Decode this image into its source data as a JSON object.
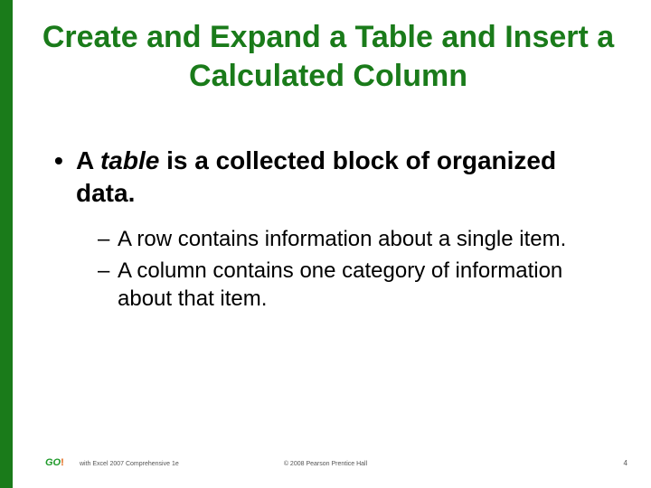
{
  "title": "Create and Expand a Table and Insert a Calculated Column",
  "bullet1_prefix": "A ",
  "bullet1_em": "table",
  "bullet1_suffix": " is a collected block of organized data.",
  "sub1": "A row contains information about a single item.",
  "sub2": "A column contains one category of information about that item.",
  "footer": {
    "logo_text": "GO",
    "logo_bang": "!",
    "book": "with Excel 2007 Comprehensive 1e",
    "copyright": "© 2008 Pearson Prentice Hall",
    "page": "4"
  }
}
